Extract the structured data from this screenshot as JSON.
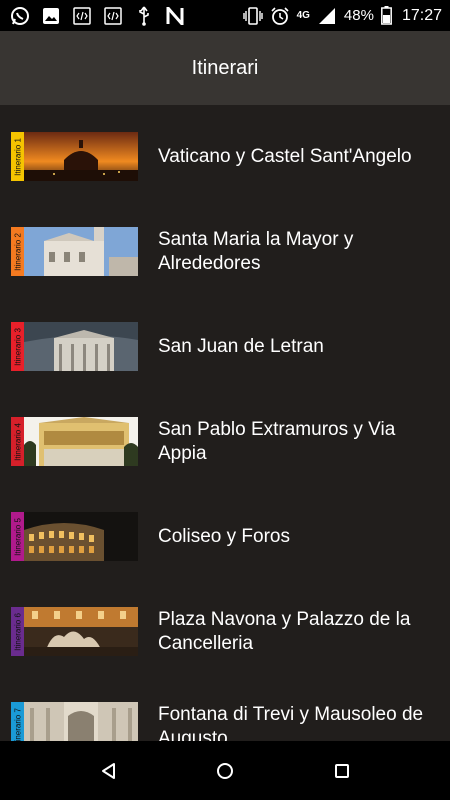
{
  "status_bar": {
    "icons_left": [
      "whatsapp-icon",
      "image-icon",
      "code-icon",
      "code-icon",
      "usb-icon",
      "n-app-icon"
    ],
    "network": "4G",
    "battery": "48%",
    "time": "17:27"
  },
  "app_bar": {
    "title": "Itinerari"
  },
  "items": [
    {
      "tab": "Itinerario 1",
      "title": "Vaticano y Castel Sant'Angelo",
      "color": "#f5c400"
    },
    {
      "tab": "Itinerario 2",
      "title": "Santa Maria la Mayor y Alrededores",
      "color": "#f47a20"
    },
    {
      "tab": "Itinerario 3",
      "title": "San Juan de Letran",
      "color": "#e8202a"
    },
    {
      "tab": "Itinerario 4",
      "title": "San Pablo Extramuros y Via Appia",
      "color": "#d6202a"
    },
    {
      "tab": "Itinerario 5",
      "title": "Coliseo y Foros",
      "color": "#b01a8c"
    },
    {
      "tab": "Itinerario 6",
      "title": "Plaza Navona y Palazzo de la Cancelleria",
      "color": "#6a2c8e"
    },
    {
      "tab": "Itinerario 7",
      "title": "Fontana di Trevi y Mausoleo de Augusto",
      "color": "#1a9ad6"
    }
  ],
  "nav_bar": {
    "icons": [
      "back-icon",
      "home-icon",
      "recents-icon"
    ]
  }
}
